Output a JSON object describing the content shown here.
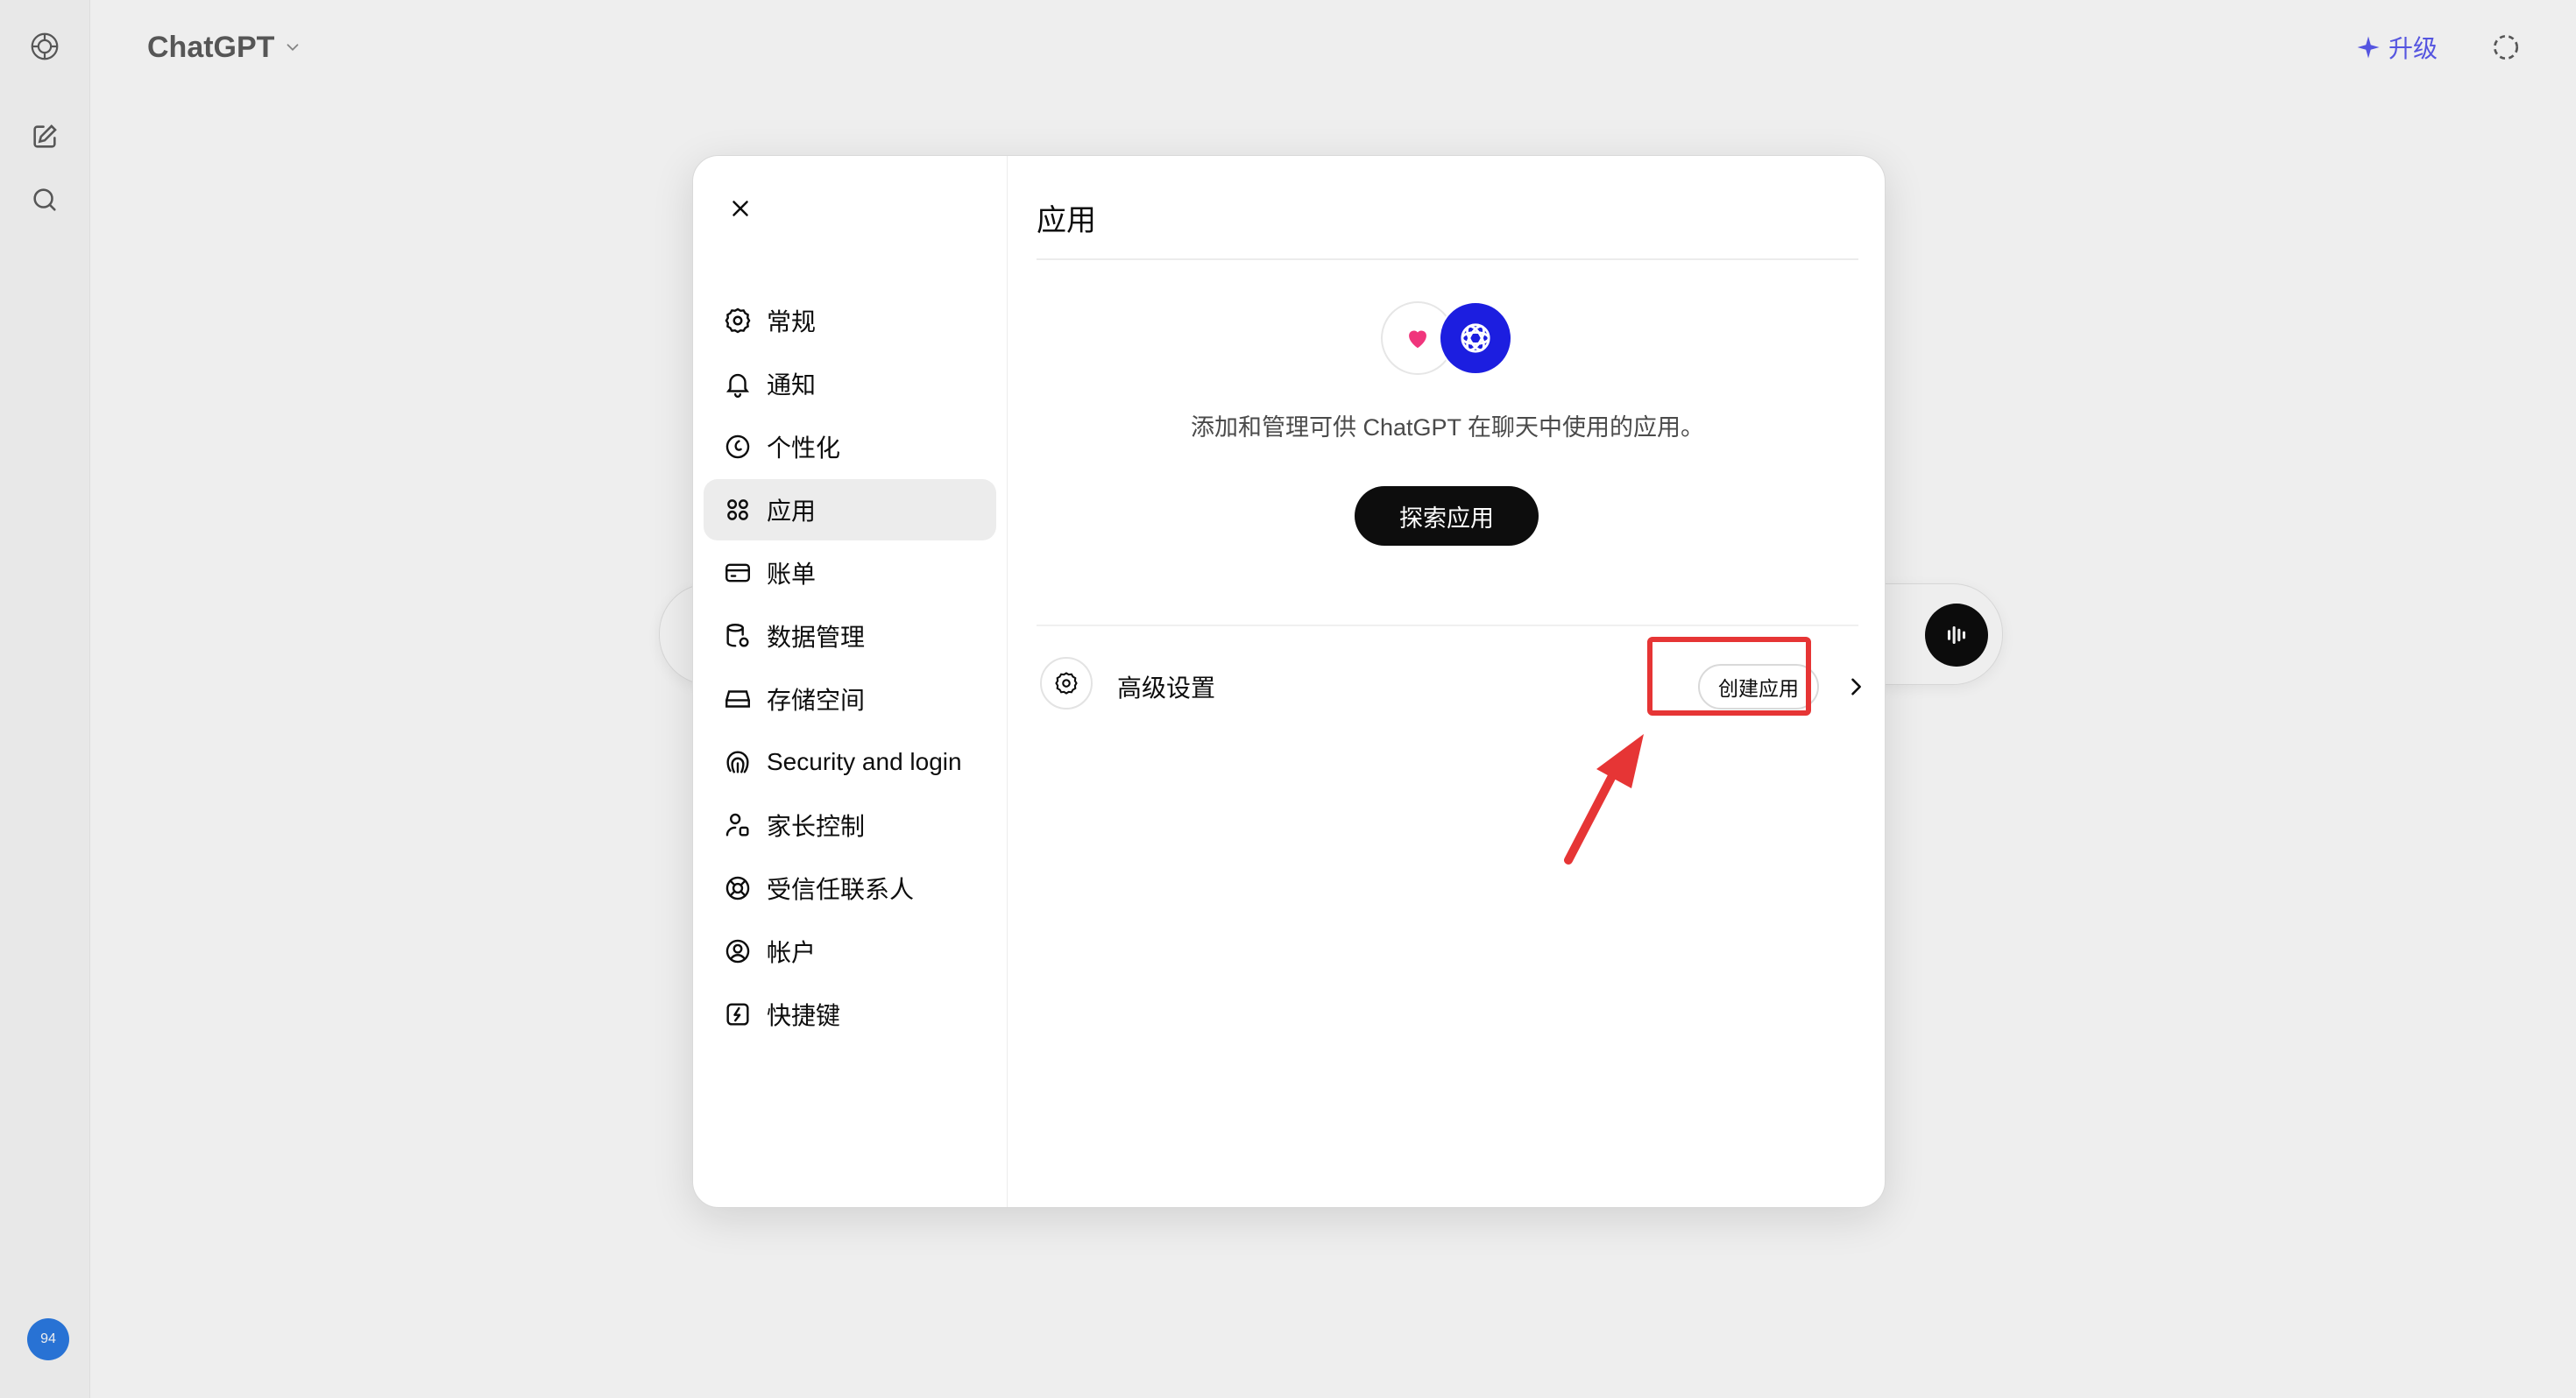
{
  "app": {
    "title": "ChatGPT",
    "upgrade_label": "升级"
  },
  "user": {
    "avatar_initials": "94"
  },
  "settings": {
    "nav": [
      {
        "label": "常规",
        "icon": "gear-icon"
      },
      {
        "label": "通知",
        "icon": "bell-icon"
      },
      {
        "label": "个性化",
        "icon": "personalization-icon"
      },
      {
        "label": "应用",
        "icon": "apps-grid-icon",
        "active": true
      },
      {
        "label": "账单",
        "icon": "credit-card-icon"
      },
      {
        "label": "数据管理",
        "icon": "database-gear-icon"
      },
      {
        "label": "存储空间",
        "icon": "storage-drive-icon"
      },
      {
        "label": "Security and login",
        "icon": "fingerprint-icon"
      },
      {
        "label": "家长控制",
        "icon": "parent-user-icon"
      },
      {
        "label": "受信任联系人",
        "icon": "lifebuoy-icon"
      },
      {
        "label": "帐户",
        "icon": "user-circle-icon"
      },
      {
        "label": "快捷键",
        "icon": "lightning-key-icon"
      }
    ],
    "apps_page": {
      "title": "应用",
      "description": "添加和管理可供 ChatGPT 在聊天中使用的应用。",
      "explore_button": "探索应用",
      "advanced": {
        "label": "高级设置",
        "create_button": "创建应用"
      }
    }
  },
  "colors": {
    "accent_upgrade": "#5c5cf0",
    "openai_logo_bg": "#1c1ee0",
    "heart": "#f0357c",
    "annotation_red": "#e63535"
  }
}
